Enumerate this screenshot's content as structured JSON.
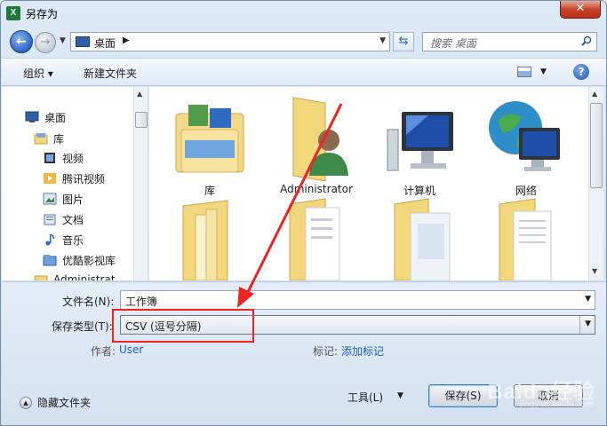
{
  "window": {
    "title": "另存为",
    "app_icon_letter": "X"
  },
  "address": {
    "location": "桌面",
    "search_placeholder": "搜索 桌面"
  },
  "toolbar": {
    "organize": "组织 ▾",
    "new_folder": "新建文件夹"
  },
  "nav_pane": {
    "items": [
      {
        "label": "桌面",
        "icon": "desktop-icon"
      },
      {
        "label": "库",
        "icon": "library-icon"
      },
      {
        "label": "视频",
        "icon": "video-icon"
      },
      {
        "label": "腾讯视频",
        "icon": "tencent-video-icon"
      },
      {
        "label": "图片",
        "icon": "picture-icon"
      },
      {
        "label": "文档",
        "icon": "document-icon"
      },
      {
        "label": "音乐",
        "icon": "music-icon"
      },
      {
        "label": "优酷影视库",
        "icon": "youku-icon"
      },
      {
        "label": "Administrat",
        "icon": "user-folder-icon"
      }
    ]
  },
  "files": [
    {
      "label": "库",
      "icon": "library-folder-icon"
    },
    {
      "label": "Administrator",
      "icon": "user-folder-icon"
    },
    {
      "label": "计算机",
      "icon": "computer-icon"
    },
    {
      "label": "网络",
      "icon": "network-icon"
    },
    {
      "label": "",
      "icon": "folder-icon"
    },
    {
      "label": "",
      "icon": "folder-icon"
    },
    {
      "label": "",
      "icon": "folder-icon"
    },
    {
      "label": "",
      "icon": "folder-icon"
    }
  ],
  "form": {
    "filename_label": "文件名(N):",
    "filename_value": "工作簿",
    "filetype_label": "保存类型(T):",
    "filetype_value": "CSV (逗号分隔)",
    "author_label": "作者:",
    "author_value": "User",
    "tags_label": "标记:",
    "tags_value": "添加标记",
    "hide_folders": "隐藏文件夹",
    "tools": "工具(L)",
    "save": "保存(S)",
    "cancel": "取消"
  },
  "watermark": {
    "text": "Baidu经验",
    "sub": "jingyan.baidu.com"
  },
  "colors": {
    "annotation": "#ee2424",
    "link": "#1f5fbf",
    "close": "#c7422a"
  }
}
